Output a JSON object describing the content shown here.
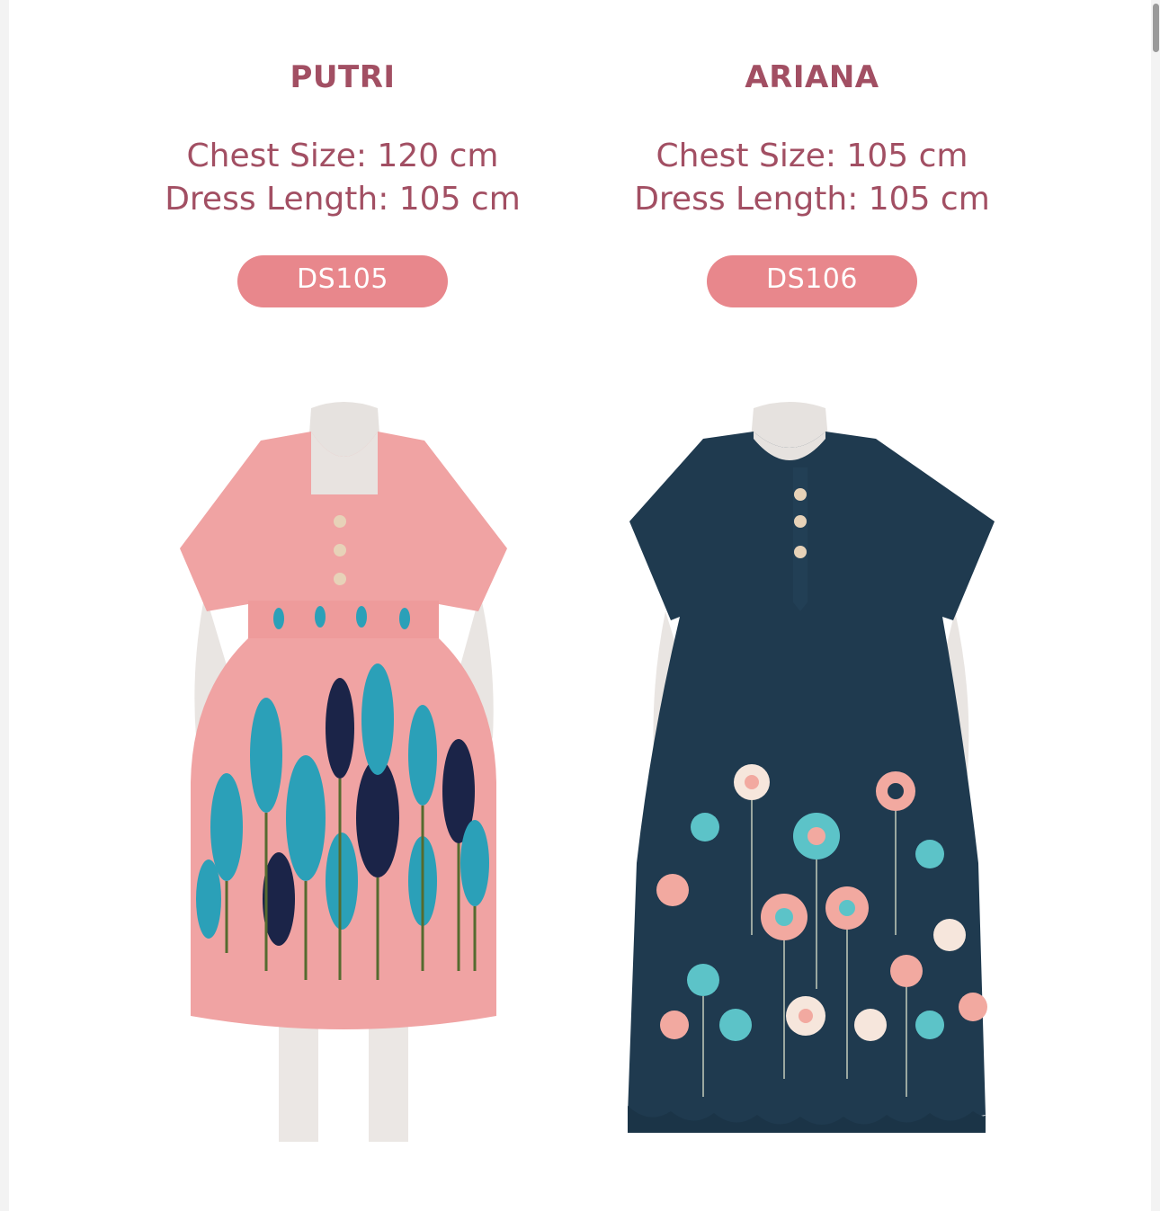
{
  "products": [
    {
      "name": "PUTRI",
      "chest": "Chest Size: 120 cm",
      "length": "Dress Length: 105 cm",
      "code": "DS105",
      "dress_color": "#f0a3a3",
      "pattern_colors": [
        "#2ba0b8",
        "#1b2448",
        "#556b2f"
      ]
    },
    {
      "name": "ARIANA",
      "chest": "Chest Size: 105 cm",
      "length": "Dress Length: 105 cm",
      "code": "DS106",
      "dress_color": "#1f3a4f",
      "pattern_colors": [
        "#f2a9a0",
        "#5cc3c8",
        "#f6e6dc"
      ]
    }
  ],
  "colors": {
    "title": "#a24f63",
    "badge": "#e8878c",
    "badge_text": "#ffffff",
    "page_bg": "#ffffff"
  }
}
